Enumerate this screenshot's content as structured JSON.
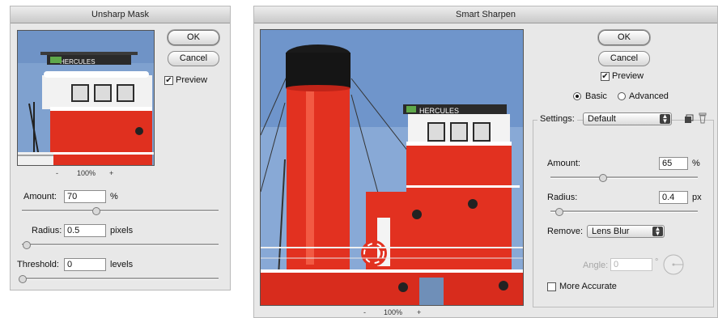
{
  "unsharp": {
    "title": "Unsharp Mask",
    "ok": "OK",
    "cancel": "Cancel",
    "preview_label": "Preview",
    "zoom_minus": "-",
    "zoom": "100%",
    "zoom_plus": "+",
    "amount_label": "Amount:",
    "amount_value": "70",
    "amount_unit": "%",
    "radius_label": "Radius:",
    "radius_value": "0.5",
    "radius_unit": "pixels",
    "threshold_label": "Threshold:",
    "threshold_value": "0",
    "threshold_unit": "levels",
    "preview_sign": "HERCULES"
  },
  "smart": {
    "title": "Smart Sharpen",
    "ok": "OK",
    "cancel": "Cancel",
    "preview_label": "Preview",
    "basic_label": "Basic",
    "advanced_label": "Advanced",
    "settings_label": "Settings:",
    "settings_value": "Default",
    "amount_label": "Amount:",
    "amount_value": "65",
    "amount_unit": "%",
    "radius_label": "Radius:",
    "radius_value": "0.4",
    "radius_unit": "px",
    "remove_label": "Remove:",
    "remove_value": "Lens Blur",
    "angle_label": "Angle:",
    "angle_value": "0",
    "angle_unit": "°",
    "more_accurate_label": "More Accurate",
    "zoom_minus": "-",
    "zoom": "100%",
    "zoom_plus": "+",
    "preview_sign": "HERCULES"
  },
  "colors": {
    "sky": "#7fa1cf",
    "hull_red": "#e0301f",
    "stack_black": "#151515",
    "white": "#ffffff"
  }
}
